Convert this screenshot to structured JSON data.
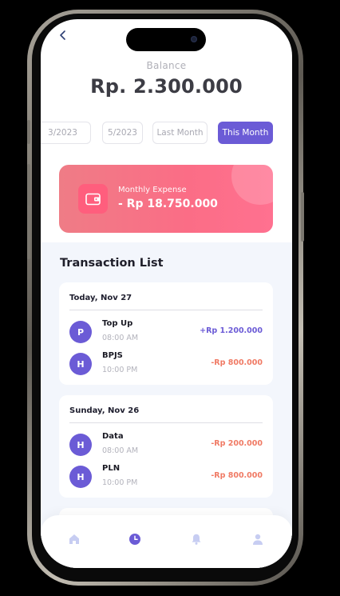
{
  "header": {
    "back_icon": "chevron-left-icon",
    "balance_label": "Balance",
    "balance_amount": "Rp. 2.300.000"
  },
  "filters": [
    {
      "label": "3/2023",
      "active": false
    },
    {
      "label": "5/2023",
      "active": false
    },
    {
      "label": "Last Month",
      "active": false
    },
    {
      "label": "This Month",
      "active": true
    }
  ],
  "expense_card": {
    "label": "Monthly Expense",
    "value": "- Rp 18.750.000",
    "icon": "wallet-icon"
  },
  "transactions": {
    "title": "Transaction List",
    "groups": [
      {
        "date": "Today, Nov 27",
        "items": [
          {
            "initial": "P",
            "name": "Top Up",
            "time": "08:00 AM",
            "amount": "+Rp 1.200.000",
            "type": "positive"
          },
          {
            "initial": "H",
            "name": "BPJS",
            "time": "10:00 PM",
            "amount": "-Rp 800.000",
            "type": "negative"
          }
        ]
      },
      {
        "date": "Sunday, Nov 26",
        "items": [
          {
            "initial": "H",
            "name": "Data",
            "time": "08:00 AM",
            "amount": "-Rp 200.000",
            "type": "negative"
          },
          {
            "initial": "H",
            "name": "PLN",
            "time": "10:00 PM",
            "amount": "-Rp 800.000",
            "type": "negative"
          }
        ]
      }
    ]
  },
  "bottom_nav": [
    {
      "icon": "home-icon",
      "active": false
    },
    {
      "icon": "history-icon",
      "active": true
    },
    {
      "icon": "bell-icon",
      "active": false
    },
    {
      "icon": "profile-icon",
      "active": false
    }
  ],
  "colors": {
    "accent": "#6b5bd6",
    "expense_gradient_start": "#ef7c86",
    "expense_gradient_end": "#ff7190",
    "negative": "#f07a64",
    "nav_inactive": "#c7cdf2"
  }
}
